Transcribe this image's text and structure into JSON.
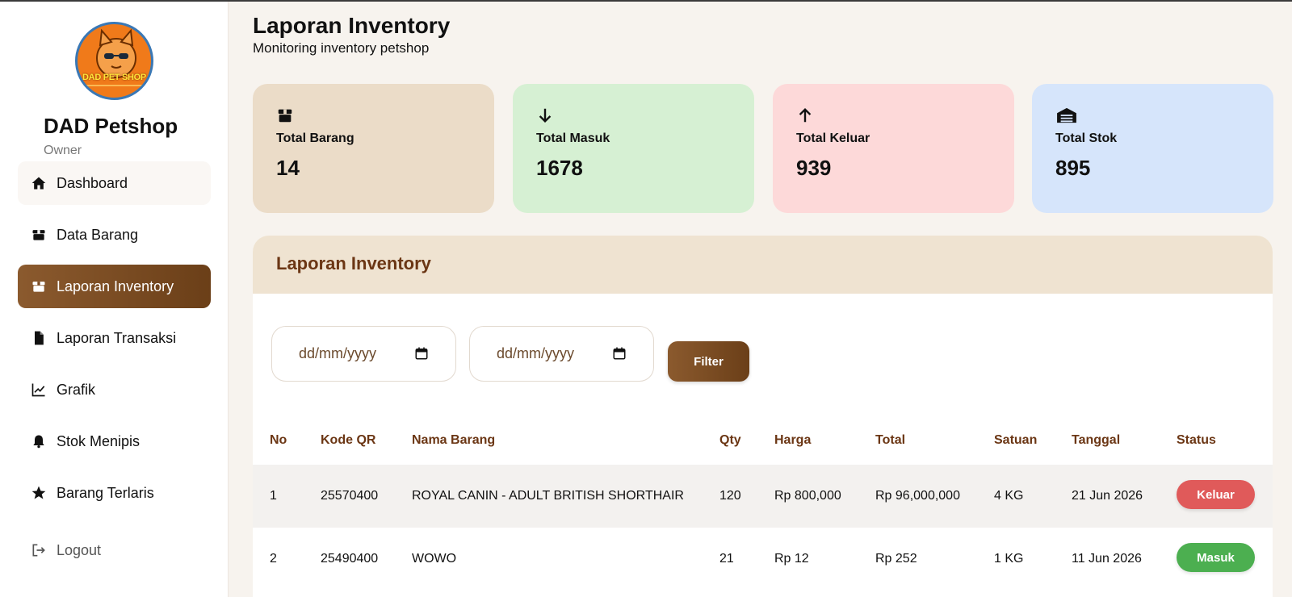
{
  "app": {
    "brand": "DAD Petshop",
    "role": "Owner",
    "logo_text": "DAD PET SHOP"
  },
  "sidebar": {
    "items": [
      {
        "label": "Dashboard",
        "icon": "home-icon",
        "state": "hover"
      },
      {
        "label": "Data Barang",
        "icon": "box-icon",
        "state": "normal"
      },
      {
        "label": "Laporan Inventory",
        "icon": "box-icon",
        "state": "active"
      },
      {
        "label": "Laporan Transaksi",
        "icon": "file-icon",
        "state": "normal"
      },
      {
        "label": "Grafik",
        "icon": "line-chart-icon",
        "state": "normal"
      },
      {
        "label": "Stok Menipis",
        "icon": "bell-icon",
        "state": "normal"
      },
      {
        "label": "Barang Terlaris",
        "icon": "star-icon",
        "state": "normal"
      }
    ],
    "logout_label": "Logout"
  },
  "header": {
    "title": "Laporan Inventory",
    "subtitle": "Monitoring inventory petshop"
  },
  "cards": [
    {
      "label": "Total Barang",
      "value": "14",
      "icon": "box-icon",
      "color": "#ebdcc8"
    },
    {
      "label": "Total Masuk",
      "value": "1678",
      "icon": "arrow-down-icon",
      "color": "#d6f0d3"
    },
    {
      "label": "Total Keluar",
      "value": "939",
      "icon": "arrow-up-icon",
      "color": "#fdd9d9"
    },
    {
      "label": "Total Stok",
      "value": "895",
      "icon": "warehouse-icon",
      "color": "#d6e5fb"
    }
  ],
  "report": {
    "title": "Laporan Inventory",
    "start_date_placeholder": "dd/mm/yyyy",
    "end_date_placeholder": "dd/mm/yyyy",
    "filter_label": "Filter",
    "columns": [
      "No",
      "Kode QR",
      "Nama Barang",
      "Qty",
      "Harga",
      "Total",
      "Satuan",
      "Tanggal",
      "Status"
    ],
    "rows": [
      {
        "no": "1",
        "kode": "25570400",
        "nama": "ROYAL CANIN - ADULT BRITISH SHORTHAIR",
        "qty": "120",
        "harga": "Rp 800,000",
        "total": "Rp 96,000,000",
        "satuan": "4 KG",
        "tanggal": "21 Jun 2026",
        "status": "Keluar"
      },
      {
        "no": "2",
        "kode": "25490400",
        "nama": "WOWO",
        "qty": "21",
        "harga": "Rp 12",
        "total": "Rp 252",
        "satuan": "1 KG",
        "tanggal": "11 Jun 2026",
        "status": "Masuk"
      }
    ]
  },
  "colors": {
    "accent": "#7a4a22",
    "status_keluar": "#e05a5a",
    "status_masuk": "#4caf50"
  }
}
